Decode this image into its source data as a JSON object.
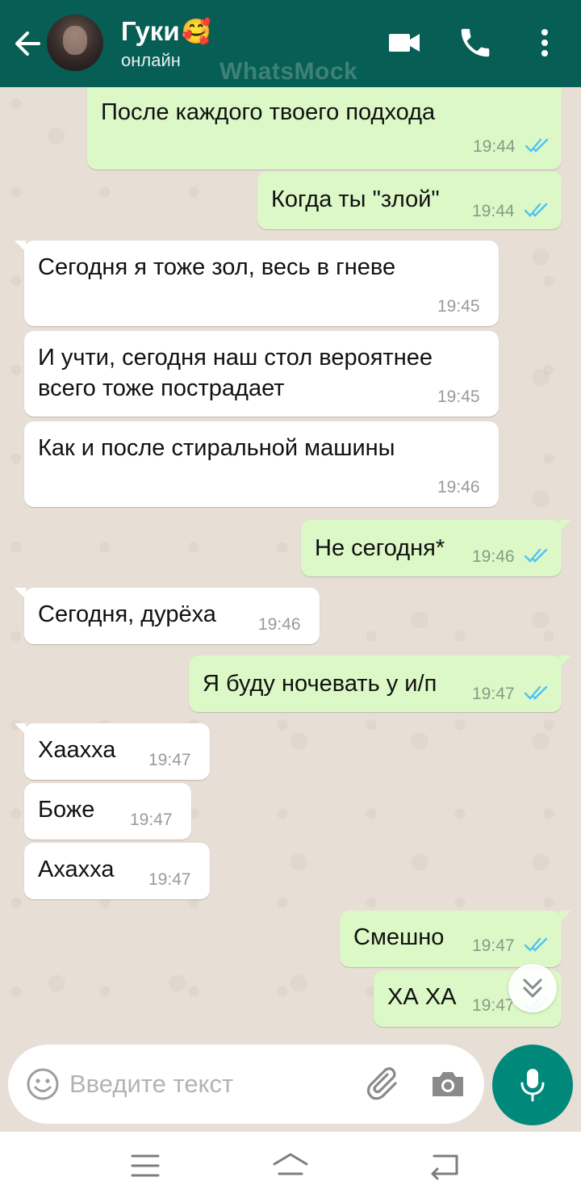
{
  "header": {
    "contact_name": "Гуки",
    "contact_emoji": "🥰",
    "status": "онлайн",
    "watermark": "WhatsMock"
  },
  "messages": [
    {
      "dir": "out",
      "text": "После каждого твоего подхода",
      "time": "19:44",
      "read": true
    },
    {
      "dir": "out",
      "text": "Когда ты \"злой\"",
      "time": "19:44",
      "read": true
    },
    {
      "dir": "in",
      "text": "Сегодня я тоже зол, весь в гневе",
      "time": "19:45"
    },
    {
      "dir": "in",
      "text": "И учти, сегодня наш стол вероятнее\nвсего тоже пострадает",
      "time": "19:45"
    },
    {
      "dir": "in",
      "text": "Как и после стиральной машины",
      "time": "19:46"
    },
    {
      "dir": "out",
      "text": "Не сегодня*",
      "time": "19:46",
      "read": true
    },
    {
      "dir": "in",
      "text": "Сегодня, дурёха",
      "time": "19:46"
    },
    {
      "dir": "out",
      "text": "Я буду ночевать у и/п",
      "time": "19:47",
      "read": true
    },
    {
      "dir": "in",
      "text": "Хаахха",
      "time": "19:47"
    },
    {
      "dir": "in",
      "text": "Боже",
      "time": "19:47"
    },
    {
      "dir": "in",
      "text": "Ахахха",
      "time": "19:47"
    },
    {
      "dir": "out",
      "text": "Смешно",
      "time": "19:47",
      "read": true
    },
    {
      "dir": "out",
      "text": "ХА ХА",
      "time": "19:47",
      "read": true
    }
  ],
  "input": {
    "placeholder": "Введите текст",
    "value": ""
  },
  "colors": {
    "header": "#075e54",
    "outgoing_bubble": "#dcf8c6",
    "incoming_bubble": "#ffffff",
    "read_check": "#4fc3f7",
    "mic_button": "#00897b",
    "chat_background": "#e7ded6"
  },
  "icons": {
    "back": "arrow-left-icon",
    "video": "video-camera-icon",
    "call": "phone-icon",
    "menu": "more-vert-icon",
    "emoji": "smiley-icon",
    "attach": "paperclip-icon",
    "camera": "camera-icon",
    "mic": "microphone-icon",
    "scroll": "double-chevron-down-icon"
  }
}
